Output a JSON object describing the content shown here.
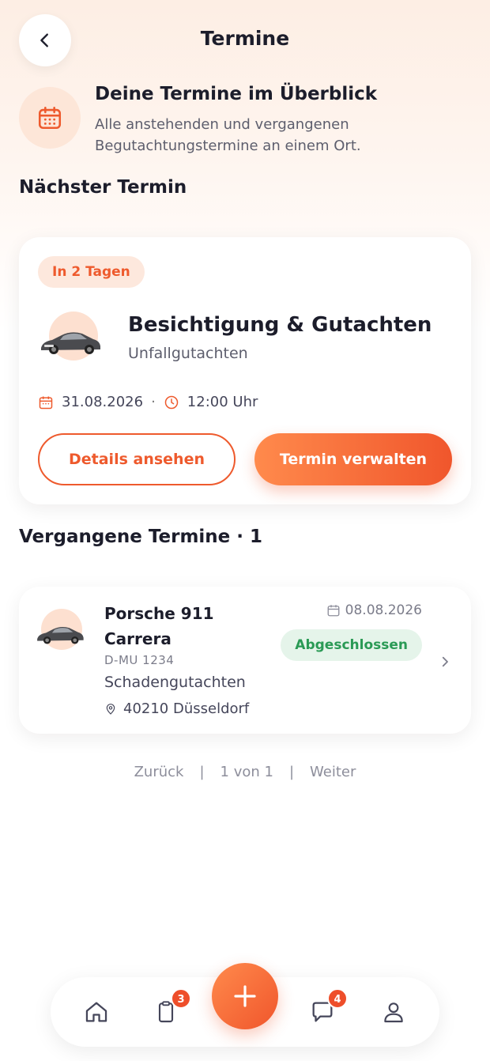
{
  "header": {
    "title": "Termine"
  },
  "intro": {
    "title": "Deine Termine im Überblick",
    "description": "Alle anstehenden und vergangenen Begutachtungstermine an einem Ort."
  },
  "next": {
    "section_title": "Nächster Termin",
    "badge": "In 2 Tagen",
    "title": "Besichtigung & Gutachten",
    "subtitle": "Unfallgutachten",
    "date": "31.08.2026",
    "separator": "·",
    "time": "12:00 Uhr",
    "details_label": "Details ansehen",
    "manage_label": "Termin verwalten"
  },
  "past": {
    "section_title": "Vergangene Termine · 1",
    "items": [
      {
        "title_line1": "Porsche 911",
        "title_line2": "Carrera",
        "plate": "D-MU 1234",
        "type": "Schadengutachten",
        "location": "40210 Düsseldorf",
        "date": "08.08.2026",
        "status": "Abgeschlossen"
      }
    ]
  },
  "pagination": {
    "prev": "Zurück",
    "sep": "|",
    "page": "1 von 1",
    "next": "Weiter"
  },
  "tabbar": {
    "clipboard_badge": "3",
    "chat_badge": "4"
  },
  "colors": {
    "accent": "#ee5a2d",
    "success": "#2a9a55",
    "badge_red": "#ee4e2a"
  }
}
